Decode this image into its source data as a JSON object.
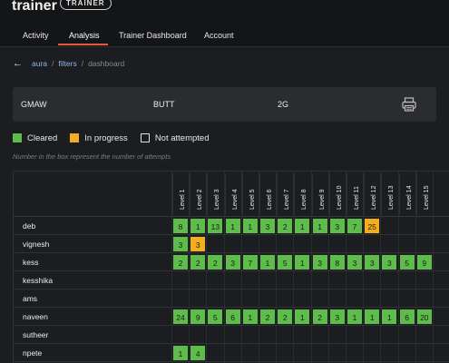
{
  "header": {
    "brand": "trainer",
    "role_badge": "TRAINER",
    "tabs": [
      "Activity",
      "Analysis",
      "Trainer Dashboard",
      "Account"
    ],
    "active_tab": "Analysis"
  },
  "breadcrumb": [
    "aura",
    "filters",
    "dashboard"
  ],
  "info": {
    "process": "GMAW",
    "joint": "BUTT",
    "position": "2G"
  },
  "legend": {
    "cleared": "Cleared",
    "in_progress": "In progress",
    "not_attempted": "Not attempted"
  },
  "colors": {
    "cleared": "#5ebd4a",
    "in_progress": "#f2ae1c",
    "accent": "#e8593c"
  },
  "note": "Number in the box represent the number of attempts",
  "levels": [
    "Level 1",
    "Level 2",
    "Level 3",
    "Level 4",
    "Level 5",
    "Level 6",
    "Level 7",
    "Level 8",
    "Level 9",
    "Level 10",
    "Level 11",
    "Level 12",
    "Level 13",
    "Level 14",
    "Level 15"
  ],
  "trainees": [
    {
      "name": "deb",
      "cells": [
        {
          "v": "8",
          "s": "c"
        },
        {
          "v": "1",
          "s": "c"
        },
        {
          "v": "13",
          "s": "c"
        },
        {
          "v": "1",
          "s": "c"
        },
        {
          "v": "1",
          "s": "c"
        },
        {
          "v": "3",
          "s": "c"
        },
        {
          "v": "2",
          "s": "c"
        },
        {
          "v": "1",
          "s": "c"
        },
        {
          "v": "1",
          "s": "c"
        },
        {
          "v": "3",
          "s": "c"
        },
        {
          "v": "7",
          "s": "c"
        },
        {
          "v": "25",
          "s": "p"
        }
      ]
    },
    {
      "name": "vignesh",
      "cells": [
        {
          "v": "3",
          "s": "c"
        },
        {
          "v": "3",
          "s": "p"
        }
      ]
    },
    {
      "name": "kess",
      "cells": [
        {
          "v": "2",
          "s": "c"
        },
        {
          "v": "2",
          "s": "c"
        },
        {
          "v": "2",
          "s": "c"
        },
        {
          "v": "3",
          "s": "c"
        },
        {
          "v": "7",
          "s": "c"
        },
        {
          "v": "1",
          "s": "c"
        },
        {
          "v": "5",
          "s": "c"
        },
        {
          "v": "1",
          "s": "c"
        },
        {
          "v": "3",
          "s": "c"
        },
        {
          "v": "8",
          "s": "c"
        },
        {
          "v": "3",
          "s": "c"
        },
        {
          "v": "3",
          "s": "c"
        },
        {
          "v": "3",
          "s": "c"
        },
        {
          "v": "5",
          "s": "c"
        },
        {
          "v": "9",
          "s": "c"
        }
      ]
    },
    {
      "name": "kesshika",
      "cells": []
    },
    {
      "name": "ams",
      "cells": []
    },
    {
      "name": "naveen",
      "cells": [
        {
          "v": "24",
          "s": "c"
        },
        {
          "v": "9",
          "s": "c"
        },
        {
          "v": "5",
          "s": "c"
        },
        {
          "v": "6",
          "s": "c"
        },
        {
          "v": "1",
          "s": "c"
        },
        {
          "v": "2",
          "s": "c"
        },
        {
          "v": "2",
          "s": "c"
        },
        {
          "v": "1",
          "s": "c"
        },
        {
          "v": "2",
          "s": "c"
        },
        {
          "v": "3",
          "s": "c"
        },
        {
          "v": "1",
          "s": "c"
        },
        {
          "v": "1",
          "s": "c"
        },
        {
          "v": "1",
          "s": "c"
        },
        {
          "v": "6",
          "s": "c"
        },
        {
          "v": "20",
          "s": "c"
        }
      ]
    },
    {
      "name": "sutheer",
      "cells": []
    },
    {
      "name": "npete",
      "cells": [
        {
          "v": "1",
          "s": "c"
        },
        {
          "v": "4",
          "s": "c"
        }
      ]
    }
  ]
}
